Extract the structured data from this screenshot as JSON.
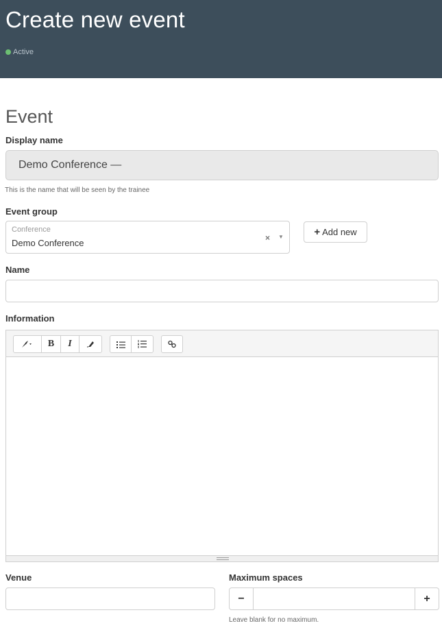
{
  "header": {
    "title": "Create new event",
    "status": "Active",
    "status_color": "#6cbf72",
    "background": "#3d4e5b"
  },
  "section": {
    "title": "Event"
  },
  "display_name": {
    "label": "Display name",
    "value": "Demo Conference —",
    "help": "This is the name that will be seen by the trainee"
  },
  "event_group": {
    "label": "Event group",
    "sublabel": "Conference",
    "value": "Demo Conference",
    "clear_icon": "×",
    "caret_icon": "▼",
    "add_button": "Add new"
  },
  "name": {
    "label": "Name",
    "value": ""
  },
  "information": {
    "label": "Information",
    "toolbar": {
      "style": "🖌▾",
      "bold": "B",
      "italic": "I",
      "eraser": "⌫",
      "ul": "☰",
      "ol": "☷",
      "link": "🔗"
    }
  },
  "venue": {
    "label": "Venue",
    "value": ""
  },
  "max_spaces": {
    "label": "Maximum spaces",
    "value": "",
    "minus": "−",
    "plus": "+",
    "help": "Leave blank for no maximum."
  }
}
